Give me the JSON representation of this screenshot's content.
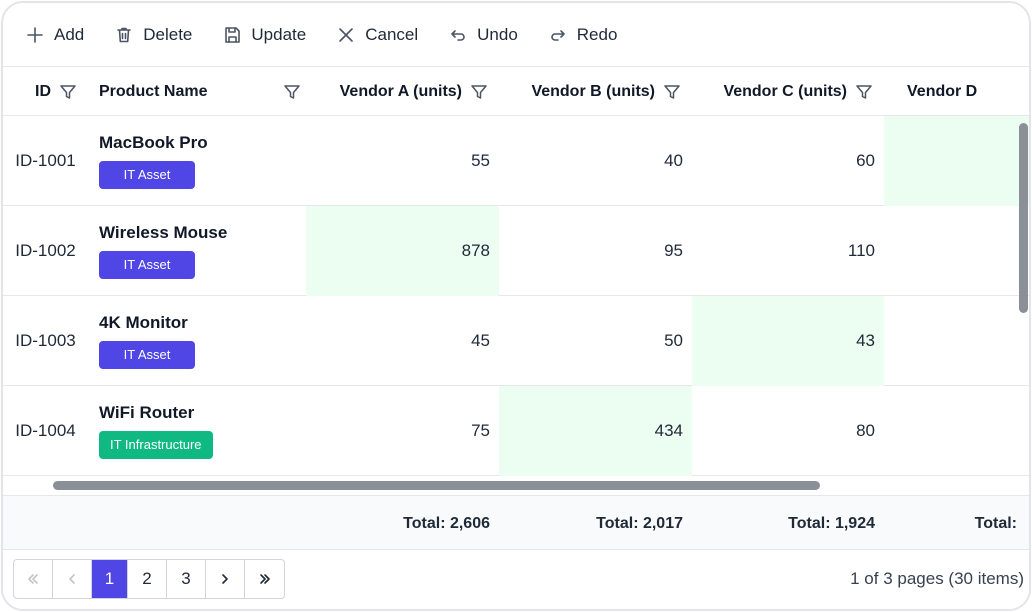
{
  "toolbar": {
    "add": "Add",
    "delete": "Delete",
    "update": "Update",
    "cancel": "Cancel",
    "undo": "Undo",
    "redo": "Redo"
  },
  "columns": {
    "id": "ID",
    "product": "Product Name",
    "vendor_a": "Vendor A (units)",
    "vendor_b": "Vendor B (units)",
    "vendor_c": "Vendor C (units)",
    "vendor_d": "Vendor D"
  },
  "rows": [
    {
      "id": "ID-1001",
      "name": "MacBook Pro",
      "category": "IT Asset",
      "a": "55",
      "b": "40",
      "c": "60",
      "d": ""
    },
    {
      "id": "ID-1002",
      "name": "Wireless Mouse",
      "category": "IT Asset",
      "a": "878",
      "b": "95",
      "c": "110",
      "d": ""
    },
    {
      "id": "ID-1003",
      "name": "4K Monitor",
      "category": "IT Asset",
      "a": "45",
      "b": "50",
      "c": "43",
      "d": ""
    },
    {
      "id": "ID-1004",
      "name": "WiFi Router",
      "category": "IT Infrastructure",
      "a": "75",
      "b": "434",
      "c": "80",
      "d": ""
    }
  ],
  "totals": {
    "a": "Total: 2,606",
    "b": "Total: 2,017",
    "c": "Total: 1,924",
    "d": "Total:"
  },
  "pager": {
    "first": "«",
    "prev": "‹",
    "pages": [
      "1",
      "2",
      "3"
    ],
    "next": "›",
    "last": "»",
    "info": "1 of 3 pages (30 items)"
  },
  "colors": {
    "badge_it_asset": "#4f46e5",
    "badge_it_infrastructure": "#10b981",
    "highlight": "#ecfdf1",
    "active_page": "#4f46e5"
  }
}
